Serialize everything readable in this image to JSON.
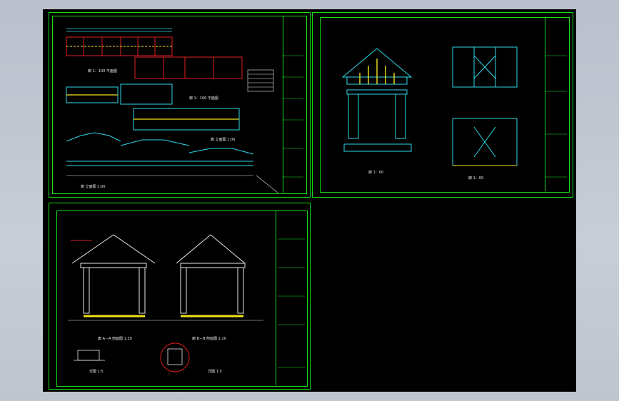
{
  "colors": {
    "background": "#000000",
    "frame": "#17e017",
    "cyan": "#2fd7e8",
    "yellow": "#f2e21a",
    "red": "#e02020",
    "white": "#e8e8e8",
    "magenta": "#d040d0"
  },
  "sheets": [
    {
      "name": "plan-sheet",
      "views": [
        "廊 1：100 平面图",
        "廊 1：100 平面图",
        "廊 立面图 1:00",
        "廊 立面图 1:00"
      ]
    },
    {
      "name": "elevation-sheet",
      "views": [
        "廊 1：00",
        "廊 1：00"
      ]
    },
    {
      "name": "section-sheet",
      "views": [
        "廊 A－A 剖面图 1:20",
        "廊 B－B 剖面图 1:20",
        "详图 1:5",
        "详图 1:5"
      ]
    }
  ]
}
